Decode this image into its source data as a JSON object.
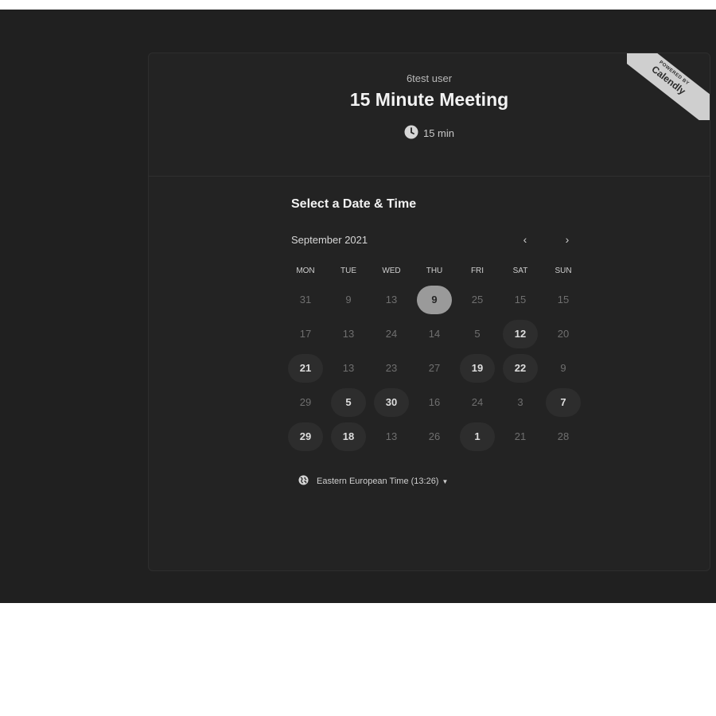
{
  "event": {
    "host": "6test user",
    "title": "15 Minute Meeting",
    "duration": "15 min",
    "duration_icon": "clock-icon"
  },
  "ribbon": {
    "powered_by": "POWERED BY",
    "brand": "Calendly"
  },
  "calendar": {
    "heading": "Select a Date & Time",
    "month": "September 2021",
    "prev": "‹",
    "next": "›",
    "days_of_week": [
      "MON",
      "TUE",
      "WED",
      "THU",
      "FRI",
      "SAT",
      "SUN"
    ],
    "weeks": [
      [
        {
          "d": "31",
          "s": "off"
        },
        {
          "d": "9",
          "s": "off"
        },
        {
          "d": "13",
          "s": "off"
        },
        {
          "d": "9",
          "s": "selected"
        },
        {
          "d": "25",
          "s": "off"
        },
        {
          "d": "15",
          "s": "off"
        },
        {
          "d": "15",
          "s": "off"
        }
      ],
      [
        {
          "d": "17",
          "s": "off"
        },
        {
          "d": "13",
          "s": "off"
        },
        {
          "d": "24",
          "s": "off"
        },
        {
          "d": "14",
          "s": "off"
        },
        {
          "d": "5",
          "s": "off"
        },
        {
          "d": "12",
          "s": "avail"
        },
        {
          "d": "20",
          "s": "off"
        }
      ],
      [
        {
          "d": "21",
          "s": "avail"
        },
        {
          "d": "13",
          "s": "off"
        },
        {
          "d": "23",
          "s": "off"
        },
        {
          "d": "27",
          "s": "off"
        },
        {
          "d": "19",
          "s": "avail"
        },
        {
          "d": "22",
          "s": "avail"
        },
        {
          "d": "9",
          "s": "off"
        }
      ],
      [
        {
          "d": "29",
          "s": "off"
        },
        {
          "d": "5",
          "s": "avail"
        },
        {
          "d": "30",
          "s": "avail"
        },
        {
          "d": "16",
          "s": "off"
        },
        {
          "d": "24",
          "s": "off"
        },
        {
          "d": "3",
          "s": "off"
        },
        {
          "d": "7",
          "s": "avail"
        }
      ],
      [
        {
          "d": "29",
          "s": "avail"
        },
        {
          "d": "18",
          "s": "avail"
        },
        {
          "d": "13",
          "s": "off"
        },
        {
          "d": "26",
          "s": "off"
        },
        {
          "d": "1",
          "s": "avail"
        },
        {
          "d": "21",
          "s": "off"
        },
        {
          "d": "28",
          "s": "off"
        }
      ]
    ]
  },
  "timezone": {
    "label": "Eastern European Time (13:26)",
    "icon": "globe-icon",
    "caret": "▼"
  },
  "colors": {
    "backdrop": "#202020",
    "card": "#232323",
    "selected": "#9a9a9a",
    "available": "#2d2d2d"
  }
}
